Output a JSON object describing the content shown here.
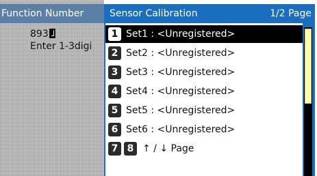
{
  "background": {
    "header": "Function Number",
    "value": "893",
    "hint": "Enter 1-3digi"
  },
  "dialog": {
    "title": "Sensor Calibration",
    "page_indicator": "1/2 Page",
    "items": [
      {
        "num": "1",
        "label": "Set1 : <Unregistered>",
        "selected": true
      },
      {
        "num": "2",
        "label": "Set2 : <Unregistered>",
        "selected": false
      },
      {
        "num": "3",
        "label": "Set3 : <Unregistered>",
        "selected": false
      },
      {
        "num": "4",
        "label": "Set4 : <Unregistered>",
        "selected": false
      },
      {
        "num": "5",
        "label": "Set5 : <Unregistered>",
        "selected": false
      },
      {
        "num": "6",
        "label": "Set6 : <Unregistered>",
        "selected": false
      }
    ],
    "page_nav": {
      "num_up": "7",
      "num_down": "8",
      "label": "↑ / ↓ Page"
    }
  },
  "scrollbar": {
    "position_fraction": 0.5
  },
  "colors": {
    "header_blue": "#1a6ec0",
    "selected_bg": "#000000",
    "scroll_thumb": "#fffcaa"
  }
}
